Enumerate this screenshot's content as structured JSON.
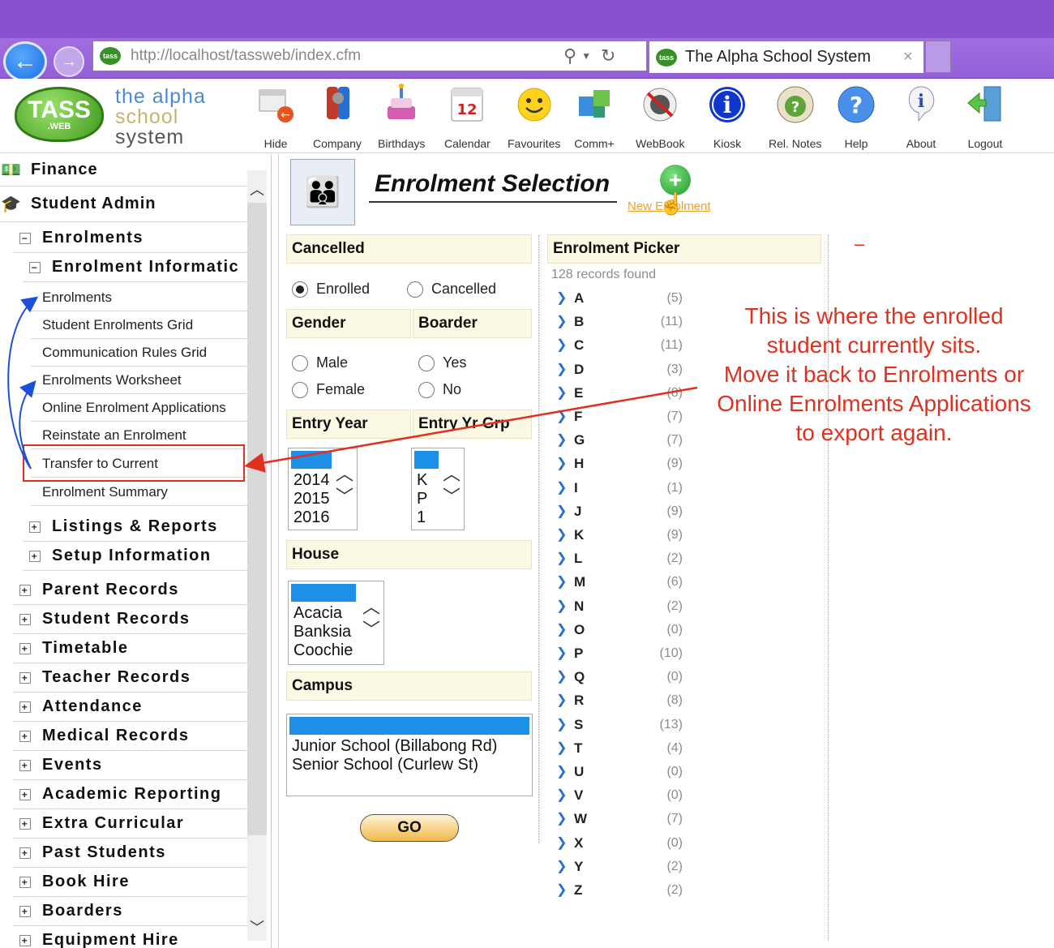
{
  "browser": {
    "url": "http://localhost/tassweb/index.cfm",
    "tab_title": "The Alpha School System",
    "close_glyph": "×"
  },
  "logo": {
    "badge_main": "TASS",
    "badge_sub": ".WEB",
    "line1": "the alpha",
    "line2": "school",
    "line3": "system"
  },
  "toolbar": {
    "items": [
      {
        "label": "Hide",
        "icon": "hide-icon"
      },
      {
        "label": "Company",
        "icon": "company-icon"
      },
      {
        "label": "Birthdays",
        "icon": "birthday-cake-icon"
      },
      {
        "label": "Calendar",
        "icon": "calendar-icon"
      },
      {
        "label": "Favourites",
        "icon": "smiley-icon"
      },
      {
        "label": "Comm+",
        "icon": "puzzle-icon"
      },
      {
        "label": "WebBook",
        "icon": "webbook-icon"
      },
      {
        "label": "Kiosk",
        "icon": "info-icon"
      },
      {
        "label": "Rel. Notes",
        "icon": "whats-new-icon"
      },
      {
        "label": "Help",
        "icon": "help-icon"
      },
      {
        "label": "About",
        "icon": "about-icon"
      },
      {
        "label": "Logout",
        "icon": "logout-icon"
      }
    ],
    "calendar_day": "12"
  },
  "nav": {
    "finance": "Finance",
    "student_admin": "Student Admin",
    "enrolments": "Enrolments",
    "enrolment_information": "Enrolment Informatic",
    "sub_items": [
      "Enrolments",
      "Student Enrolments Grid",
      "Communication Rules Grid",
      "Enrolments Worksheet",
      "Online Enrolment Applications",
      "Reinstate an Enrolment",
      "Transfer to Current",
      "Enrolment Summary"
    ],
    "listings_reports": "Listings & Reports",
    "setup_information": "Setup Information",
    "sections": [
      "Parent Records",
      "Student Records",
      "Timetable",
      "Teacher Records",
      "Attendance",
      "Medical Records",
      "Events",
      "Academic Reporting",
      "Extra Curricular",
      "Past Students",
      "Book Hire",
      "Boarders",
      "Equipment Hire"
    ]
  },
  "page": {
    "title": "Enrolment Selection",
    "new_enrolment": "New Enrolment"
  },
  "filters": {
    "cancelled_head": "Cancelled",
    "enrolled_label": "Enrolled",
    "cancelled_label": "Cancelled",
    "status_selected": "Enrolled",
    "gender_head": "Gender",
    "male_label": "Male",
    "female_label": "Female",
    "boarder_head": "Boarder",
    "yes_label": "Yes",
    "no_label": "No",
    "entry_year_head": "Entry Year",
    "entry_years": [
      "2014",
      "2015",
      "2016"
    ],
    "entry_yr_grp_head": "Entry Yr Grp",
    "entry_yr_grps": [
      "K",
      "P",
      "1"
    ],
    "house_head": "House",
    "houses": [
      "Acacia",
      "Banksia",
      "Coochie"
    ],
    "campus_head": "Campus",
    "campuses": [
      "Junior School (Billabong Rd)",
      "Senior School (Curlew St)"
    ],
    "go_label": "GO"
  },
  "picker": {
    "head": "Enrolment Picker",
    "records_found": "128 records found",
    "letters": [
      {
        "letter": "A",
        "count": "(5)"
      },
      {
        "letter": "B",
        "count": "(11)"
      },
      {
        "letter": "C",
        "count": "(11)"
      },
      {
        "letter": "D",
        "count": "(3)"
      },
      {
        "letter": "E",
        "count": "(8)"
      },
      {
        "letter": "F",
        "count": "(7)"
      },
      {
        "letter": "G",
        "count": "(7)"
      },
      {
        "letter": "H",
        "count": "(9)"
      },
      {
        "letter": "I",
        "count": "(1)"
      },
      {
        "letter": "J",
        "count": "(9)"
      },
      {
        "letter": "K",
        "count": "(9)"
      },
      {
        "letter": "L",
        "count": "(2)"
      },
      {
        "letter": "M",
        "count": "(6)"
      },
      {
        "letter": "N",
        "count": "(2)"
      },
      {
        "letter": "O",
        "count": "(0)"
      },
      {
        "letter": "P",
        "count": "(10)"
      },
      {
        "letter": "Q",
        "count": "(0)"
      },
      {
        "letter": "R",
        "count": "(8)"
      },
      {
        "letter": "S",
        "count": "(13)"
      },
      {
        "letter": "T",
        "count": "(4)"
      },
      {
        "letter": "U",
        "count": "(0)"
      },
      {
        "letter": "V",
        "count": "(0)"
      },
      {
        "letter": "W",
        "count": "(7)"
      },
      {
        "letter": "X",
        "count": "(0)"
      },
      {
        "letter": "Y",
        "count": "(2)"
      },
      {
        "letter": "Z",
        "count": "(2)"
      }
    ]
  },
  "annotation": {
    "dash": "–",
    "lines": [
      "This is where the enrolled",
      "student currently sits.",
      "Move it back to Enrolments or",
      "Online Enrolments Applications",
      "to export again."
    ],
    "color": "#e03020"
  }
}
